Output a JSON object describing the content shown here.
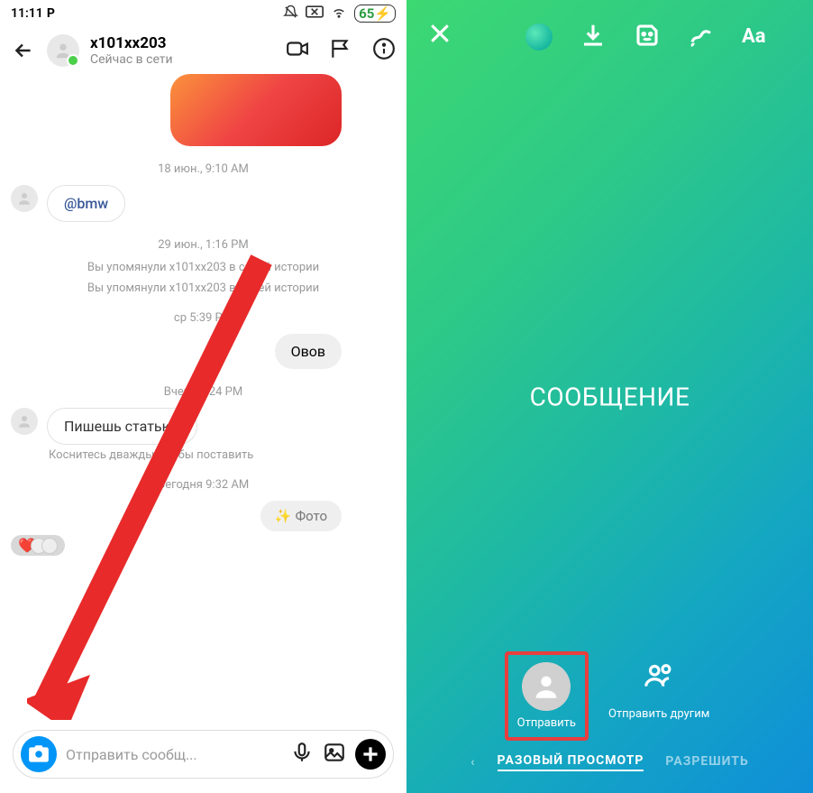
{
  "statusbar": {
    "time": "11:11",
    "app_indicator": "P",
    "battery": "65"
  },
  "chat": {
    "username": "x101xx203",
    "status": "Сейчас в сети",
    "ts1": "18 июн., 9:10 AM",
    "mention": "@bmw",
    "ts2": "29 июн., 1:16 PM",
    "sys1": "Вы упомянули x101xx203 в своей истории",
    "sys2": "Вы упомянули x101xx203 в своей истории",
    "ts3": "ср 5:39 PM",
    "out1": "Овов",
    "ts4": "Вчера 9:24 PM",
    "in1": "Пишешь статью?",
    "hint": "Коснитесь дважды, чтобы поставить",
    "ts5": "Сегодня 9:32 AM",
    "photo_chip": "Фото",
    "heart": "❤️"
  },
  "composer": {
    "placeholder": "Отправить сообщ..."
  },
  "story": {
    "text_tool": "Aa",
    "message": "СООБЩЕНИЕ",
    "send": "Отправить",
    "send_others": "Отправить другим",
    "tab_once": "РАЗОВЫЙ ПРОСМОТР",
    "tab_allow": "РАЗРЕШИТЬ"
  }
}
